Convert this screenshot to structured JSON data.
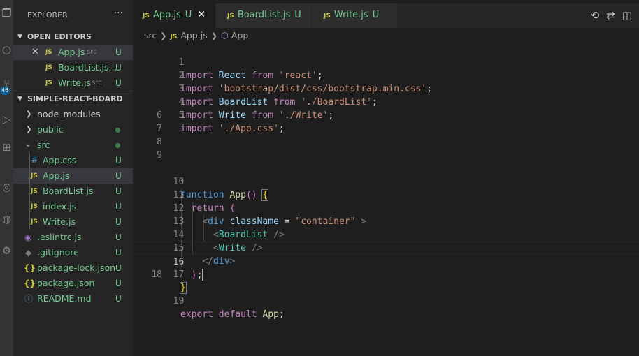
{
  "sidebar": {
    "title": "EXPLORER",
    "more": "···",
    "open_editors": {
      "label": "OPEN EDITORS",
      "items": [
        {
          "icon": "JS",
          "name": "App.js",
          "dir": "src",
          "status": "U"
        },
        {
          "icon": "JS",
          "name": "BoardList.js...",
          "dir": "",
          "status": "U"
        },
        {
          "icon": "JS",
          "name": "Write.js",
          "dir": "src",
          "status": "U"
        }
      ]
    },
    "project": {
      "label": "SIMPLE-REACT-BOARD",
      "items": [
        {
          "name": "node_modules",
          "status": ""
        },
        {
          "name": "public",
          "status": ""
        },
        {
          "name": "src",
          "status": ""
        },
        {
          "icon": "#",
          "name": "App.css",
          "status": "U"
        },
        {
          "icon": "JS",
          "name": "App.js",
          "status": "U"
        },
        {
          "icon": "JS",
          "name": "BoardList.js",
          "status": "U"
        },
        {
          "icon": "JS",
          "name": "index.js",
          "status": "U"
        },
        {
          "icon": "JS",
          "name": "Write.js",
          "status": "U"
        },
        {
          "name": ".eslintrc.js",
          "status": "U"
        },
        {
          "name": ".gitignore",
          "status": "U"
        },
        {
          "icon": "{}",
          "name": "package-lock.json",
          "status": "U"
        },
        {
          "icon": "{}",
          "name": "package.json",
          "status": "U"
        },
        {
          "name": "README.md",
          "status": "U"
        }
      ]
    }
  },
  "activity": {
    "badge": "46"
  },
  "tabs": [
    {
      "icon": "JS",
      "name": "App.js",
      "status": "U",
      "active": true
    },
    {
      "icon": "JS",
      "name": "BoardList.js",
      "status": "U"
    },
    {
      "icon": "JS",
      "name": "Write.js",
      "status": "U"
    }
  ],
  "breadcrumb": {
    "folder": "src",
    "icon": "JS",
    "file": "App.js",
    "symbol": "App"
  },
  "editor": {
    "current_line": 16,
    "line_numbers": [
      "1",
      "2",
      "3",
      "4",
      "5",
      "6",
      "7",
      "8",
      "9",
      "10",
      "11",
      "12",
      "13",
      "14",
      "15",
      "16",
      "17",
      "18",
      "19"
    ],
    "code": {
      "l1": {
        "kw1": "import",
        "id": "React",
        "kw2": "from",
        "str": "'react'",
        "end": ";"
      },
      "l2": {
        "kw1": "import",
        "str": "'bootstrap/dist/css/bootstrap.min.css'",
        "end": ";"
      },
      "l3": {
        "kw1": "import",
        "id": "BoardList",
        "kw2": "from",
        "str": "'./BoardList'",
        "end": ";"
      },
      "l4": {
        "kw1": "import",
        "id": "Write",
        "kw2": "from",
        "str": "'./Write'",
        "end": ";"
      },
      "l5": {
        "kw1": "import",
        "str": "'./App.css'",
        "end": ";"
      },
      "l10": {
        "kw": "function",
        "fn": "App",
        "parens": "()",
        "brace": "{"
      },
      "l11": {
        "kw": "return",
        "paren": "("
      },
      "l12": {
        "lt": "<",
        "tag": "div",
        "attr": "className",
        "eq": "=",
        "str": "\"container\"",
        "gt": ">"
      },
      "l13": {
        "lt": "<",
        "comp": "BoardList",
        "close": "/>"
      },
      "l14": {
        "lt": "<",
        "comp": "Write",
        "close": "/>"
      },
      "l15": {
        "lt": "</",
        "tag": "div",
        "gt": ">"
      },
      "l16": {
        "paren": ")",
        "end": ";"
      },
      "l17": {
        "brace": "}"
      },
      "l19": {
        "kw1": "export",
        "kw2": "default",
        "id": "App",
        "end": ";"
      }
    }
  },
  "colors": {
    "accent": "#73c991",
    "js_icon": "#cbcb41",
    "background": "#1e1e1e"
  }
}
